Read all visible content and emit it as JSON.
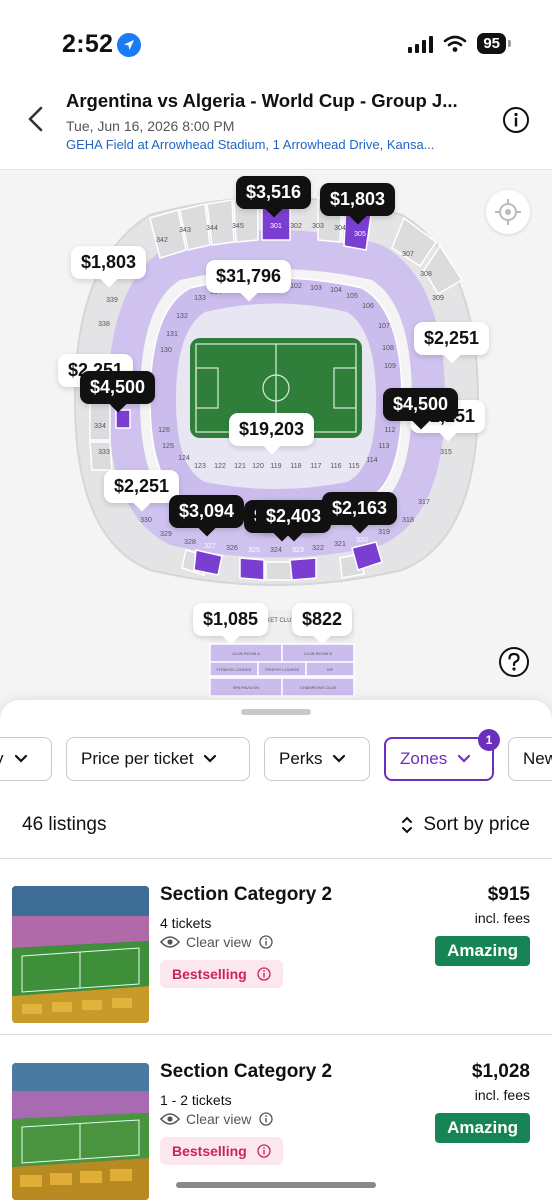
{
  "status_bar": {
    "time": "2:52",
    "battery": "95"
  },
  "header": {
    "title": "Argentina vs Algeria - World Cup - Group J...",
    "datetime": "Tue, Jun 16, 2026 8:00 PM",
    "venue": "GEHA Field at Arrowhead Stadium, 1 Arrowhead Drive, Kansa..."
  },
  "map": {
    "sections": {
      "upper_top": [
        "342",
        "343",
        "344",
        "345",
        "346",
        "301",
        "302",
        "303",
        "304",
        "305"
      ],
      "upper_right": [
        "307",
        "308",
        "309",
        "312",
        "315",
        "317",
        "318"
      ],
      "upper_bottom": [
        "330",
        "329",
        "328",
        "327",
        "326",
        "325",
        "324",
        "323",
        "322",
        "321",
        "320",
        "319"
      ],
      "upper_left": [
        "341",
        "339",
        "338",
        "334",
        "333"
      ],
      "lower_top": [
        "133",
        "134",
        "135",
        "136",
        "101",
        "102",
        "103",
        "104",
        "105",
        "106"
      ],
      "lower_right": [
        "107",
        "108",
        "109",
        "112",
        "113",
        "114"
      ],
      "lower_bottom": [
        "124",
        "123",
        "122",
        "121",
        "120",
        "119",
        "118",
        "117",
        "116",
        "115"
      ],
      "lower_left": [
        "132",
        "131",
        "130",
        "126",
        "125"
      ]
    },
    "price_tags": [
      {
        "label": "$3,516",
        "style": "dark"
      },
      {
        "label": "$1,803",
        "style": "dark"
      },
      {
        "label": "$1,803",
        "style": "light"
      },
      {
        "label": "$31,796",
        "style": "light"
      },
      {
        "label": "$2,251",
        "style": "light"
      },
      {
        "label": "$2,251",
        "style": "light"
      },
      {
        "label": "$4,500",
        "style": "dark"
      },
      {
        "label": "$4,500",
        "style": "dark"
      },
      {
        "label": "$2,251",
        "style": "light"
      },
      {
        "label": "$19,203",
        "style": "light"
      },
      {
        "label": "$2,251",
        "style": "light"
      },
      {
        "label": "$3,094",
        "style": "dark"
      },
      {
        "label": "$2,403",
        "style": "dark"
      },
      {
        "label": "$2,403",
        "style": "dark"
      },
      {
        "label": "$2,163",
        "style": "dark"
      },
      {
        "label": "$1,085",
        "style": "light"
      },
      {
        "label": "$822",
        "style": "light"
      }
    ],
    "club_area": {
      "header": "TICKET CLUB",
      "rooms": [
        "CLUB ROOM A",
        "CLUB ROOM B",
        "CLUB ROOM C",
        "FITNESS LOUNGE",
        "TROPHY LOUNGE",
        "VIP",
        "SPA PAVILION",
        "CHAMPIONS CLUB"
      ]
    }
  },
  "filters": [
    {
      "label": "y"
    },
    {
      "label": "Price per ticket"
    },
    {
      "label": "Perks"
    },
    {
      "label": "Zones",
      "active": true,
      "badge": "1"
    },
    {
      "label": "New"
    }
  ],
  "list_header": {
    "count": "46 listings",
    "sort": "Sort by price"
  },
  "listings": [
    {
      "title": "Section Category 2",
      "quantity": "4 tickets",
      "view": "Clear view",
      "tag": "Bestselling",
      "price": "$915",
      "fees": "incl. fees",
      "deal": "Amazing"
    },
    {
      "title": "Section Category 2",
      "quantity": "1 - 2 tickets",
      "view": "Clear view",
      "tag": "Bestselling",
      "price": "$1,028",
      "fees": "incl. fees",
      "deal": "Amazing"
    }
  ],
  "colors": {
    "accent": "#6b2fbd",
    "deal": "#178456",
    "bestselling_bg": "#fde7ee",
    "bestselling_text": "#c8245a",
    "link": "#1f64c5",
    "section_available": "#c9b8ee",
    "section_selected": "#7a3fd0",
    "field": "#2f7f3a"
  }
}
